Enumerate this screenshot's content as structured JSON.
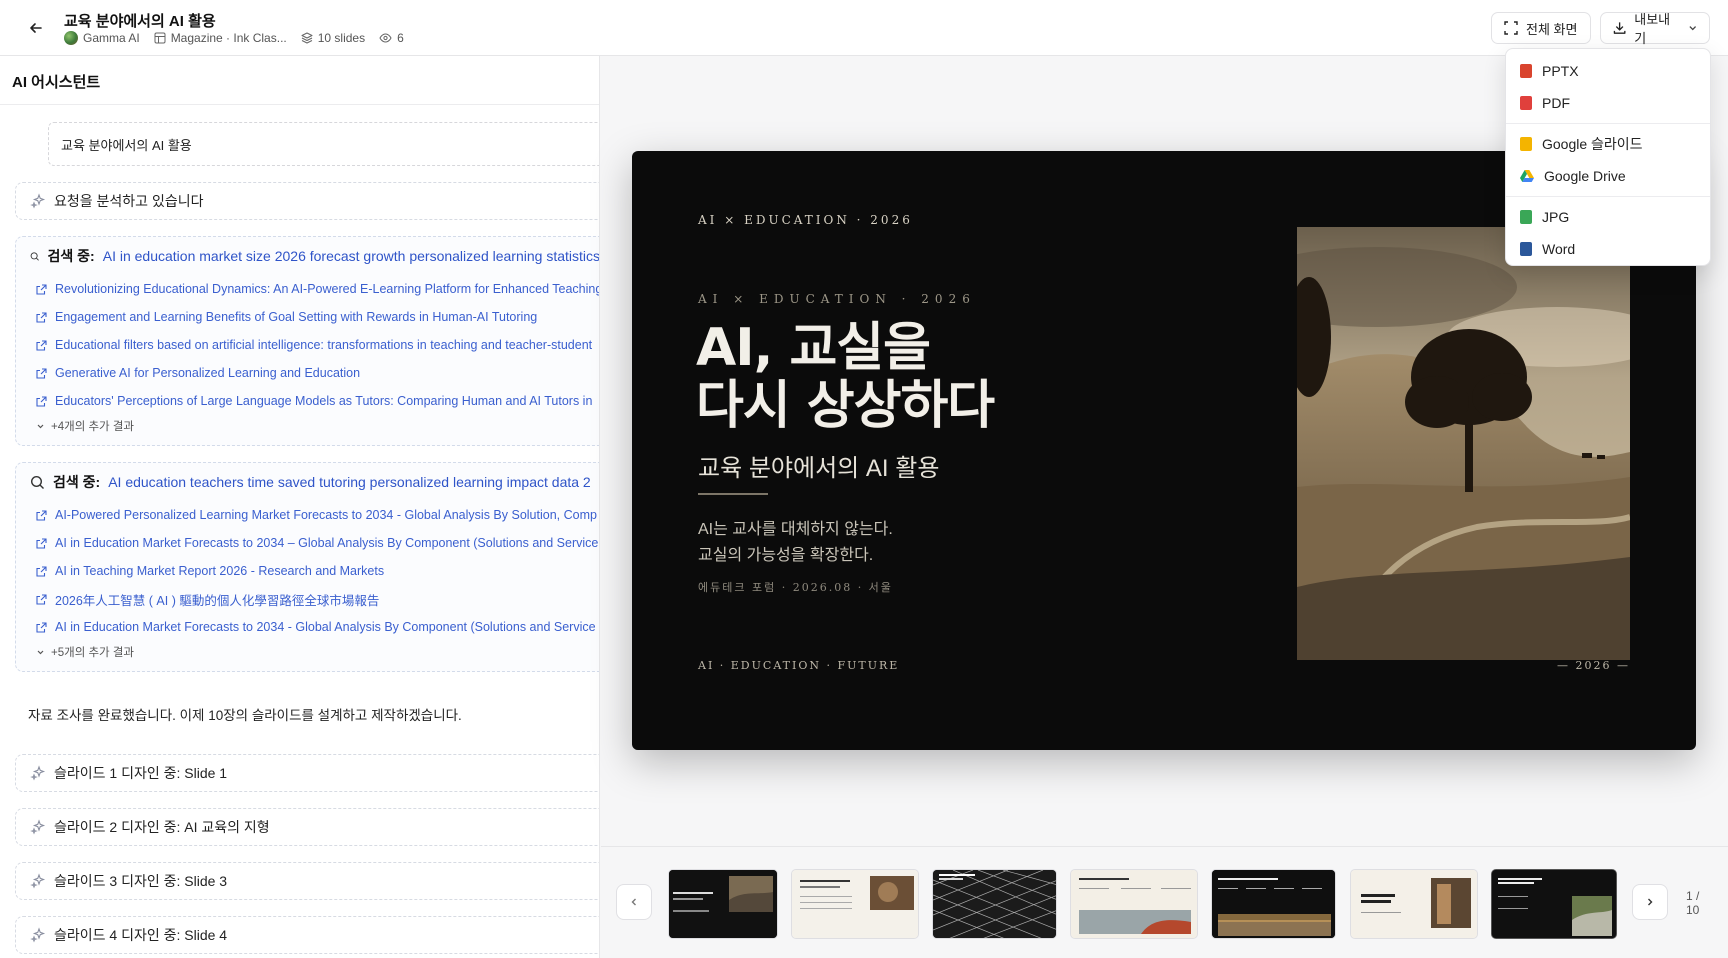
{
  "header": {
    "title": "교육 분야에서의 AI 활용",
    "workspace": "Gamma AI",
    "theme": "Magazine · Ink Clas...",
    "slide_count": "10 slides",
    "views": "6",
    "fullscreen_label": "전체 화면",
    "export_label": "내보내기"
  },
  "export_menu": {
    "items": [
      {
        "label": "PPTX",
        "color": "#d9442e"
      },
      {
        "label": "PDF",
        "color": "#e0403c"
      },
      {
        "label": "Google 슬라이드",
        "color": "#f4b400"
      },
      {
        "label": "Google Drive",
        "color": "#1fa463"
      },
      {
        "label": "JPG",
        "color": "#3aa757"
      },
      {
        "label": "Word",
        "color": "#2b579a"
      }
    ]
  },
  "assistant": {
    "title": "AI 어시스턴트",
    "prompt": "교육 분야에서의 AI 활용",
    "analyzing": "요청을 분석하고 있습니다",
    "searches": [
      {
        "label": "검색 중:",
        "query": "AI in education market size 2026 forecast growth personalized learning statistics",
        "results": [
          "Revolutionizing Educational Dynamics: An AI-Powered E-Learning Platform for Enhanced Teaching",
          "Engagement and Learning Benefits of Goal Setting with Rewards in Human-AI Tutoring",
          "Educational filters based on artificial intelligence: transformations in teaching and teacher-student",
          "Generative AI for Personalized Learning and Education",
          "Educators' Perceptions of Large Language Models as Tutors: Comparing Human and AI Tutors in"
        ],
        "more": "+4개의 추가 결과"
      },
      {
        "label": "검색 중:",
        "query": "AI education teachers time saved tutoring personalized learning impact data 2",
        "results": [
          "AI-Powered Personalized Learning Market Forecasts to 2034 - Global Analysis By Solution, Comp",
          "AI in Education Market Forecasts to 2034 – Global Analysis By Component (Solutions and Service",
          "AI in Teaching Market Report 2026 - Research and Markets",
          "2026年人工智慧 ( AI ) 驅動的個人化學習路徑全球市場報告",
          "AI in Education Market Forecasts to 2034 - Global Analysis By Component (Solutions and Service"
        ],
        "more": "+5개의 추가 결과"
      }
    ],
    "done_message": "자료 조사를 완료했습니다. 이제 10장의 슬라이드를 설계하고 제작하겠습니다.",
    "design_steps": [
      "슬라이드 1 디자인 중: Slide 1",
      "슬라이드 2 디자인 중: AI 교육의 지형",
      "슬라이드 3 디자인 중: Slide 3",
      "슬라이드 4 디자인 중: Slide 4"
    ]
  },
  "slide": {
    "kicker_top": "AI × EDUCATION · 2026",
    "kicker_mid": "AI × EDUCATION · 2026",
    "title_line1": "AI, 교실을",
    "title_line2": "다시 상상하다",
    "subtitle": "교육 분야에서의 AI 활용",
    "body_line1": "AI는 교사를 대체하지 않는다.",
    "body_line2": "교실의 가능성을 확장한다.",
    "byline": "에듀테크 포럼 · 2026.08 · 서울",
    "footer_left": "AI · EDUCATION · FUTURE",
    "footer_right": "— 2026 —"
  },
  "thumbnails": {
    "t2_title": "AI에서 교실에 AI의 역할",
    "t3_title": "교실에서의",
    "t4_title": "수업의 협업적 재발견",
    "t5_title": "교사의 역할 재정의",
    "t6_title": "AI가 아이들의 사고력을 확장한다",
    "t7_title": "AI 도입 교육 혁명의 다음 단계"
  },
  "pager": {
    "current": "1 /",
    "total": "10"
  }
}
